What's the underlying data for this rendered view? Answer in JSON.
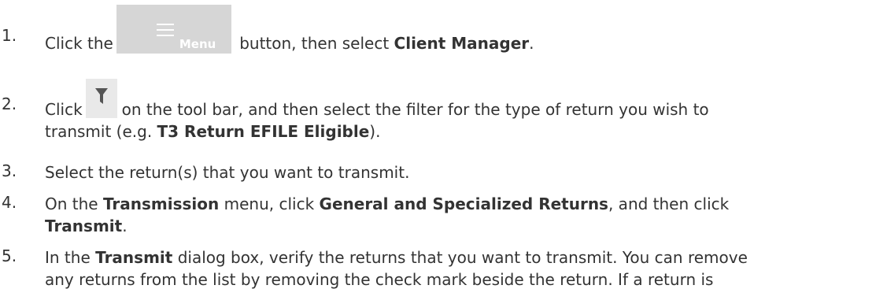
{
  "steps": [
    {
      "number": "1.",
      "segments": {
        "a": "Click the",
        "button_label": "Menu",
        "b": "button, then select",
        "c": "Client Manager",
        "d": "."
      }
    },
    {
      "number": "2.",
      "segments": {
        "a": "Click",
        "b": "on the tool bar, and then select the filter for the type of return you wish to",
        "c": "transmit (e.g.",
        "d": "T3 Return EFILE Eligible",
        "e": ")."
      }
    },
    {
      "number": "3.",
      "segments": {
        "a": "Select the return(s) that you want to transmit."
      }
    },
    {
      "number": "4.",
      "segments": {
        "a": "On the",
        "b": "Transmission",
        "c": "menu, click",
        "d": "General and Specialized Returns",
        "e": ", and then click",
        "f": "Transmit",
        "g": "."
      }
    },
    {
      "number": "5.",
      "segments": {
        "a": "In the",
        "b": "Transmit",
        "c": "dialog box, verify the returns that you want to transmit. You can remove",
        "d": "any returns from the list by removing the check mark beside the return. If a return is"
      }
    }
  ],
  "icons": {
    "menu_button_icon": "hamburger-icon",
    "filter_icon": "filter-icon"
  },
  "colors": {
    "text": "#333333",
    "menu_button_bg": "#d6d6d6",
    "filter_icon": "#555555"
  }
}
